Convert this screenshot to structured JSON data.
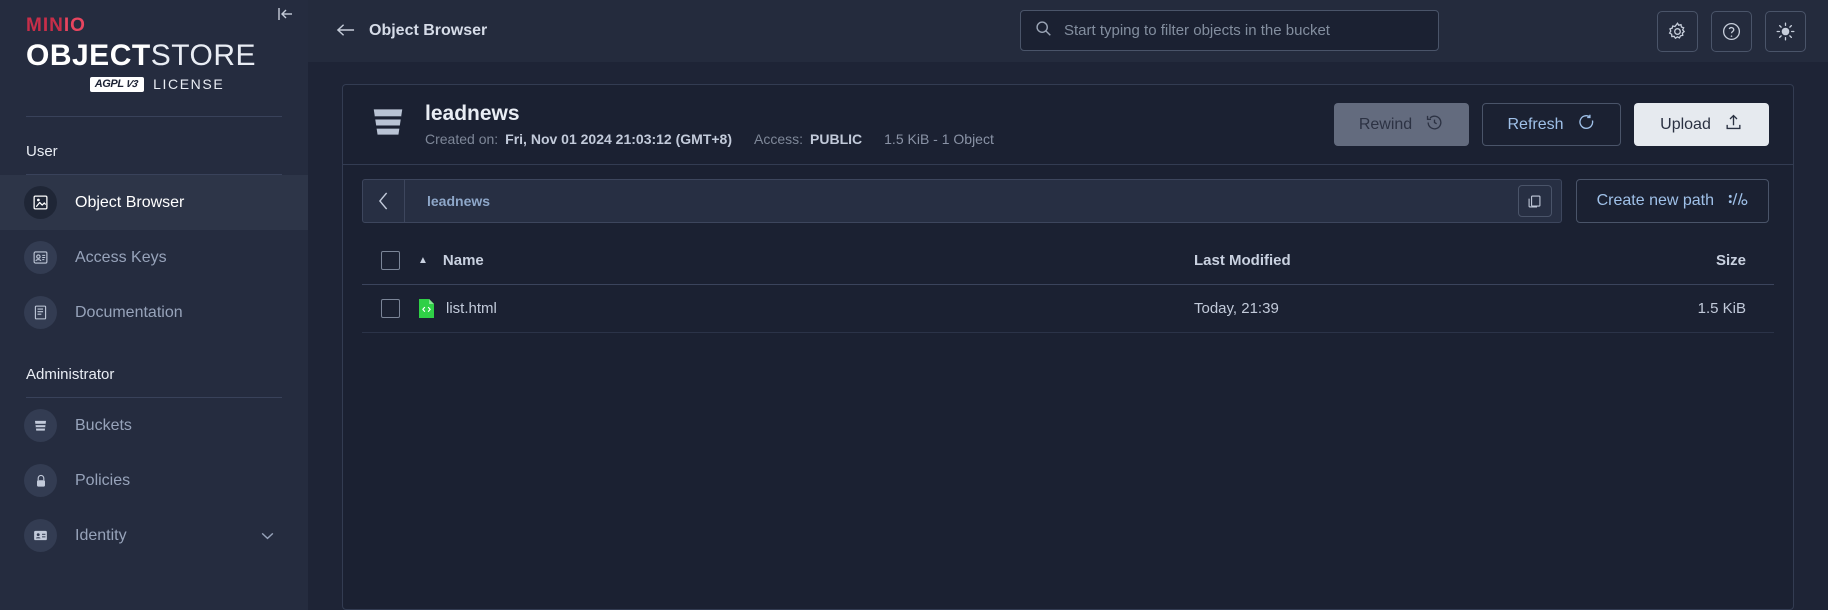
{
  "sidebar": {
    "logo": {
      "brand": "MIN",
      "brand_suffix": "IO",
      "product_bold": "OBJECT",
      "product_light": "STORE",
      "badge": "AGPL",
      "badge_version": "V3",
      "license": "LICENSE"
    },
    "collapse_icon": "collapse-left-icon",
    "groups": [
      {
        "title": "User",
        "items": [
          {
            "label": "Object Browser",
            "icon": "object-browser-icon",
            "active": true
          },
          {
            "label": "Access Keys",
            "icon": "access-keys-icon",
            "active": false
          },
          {
            "label": "Documentation",
            "icon": "documentation-icon",
            "active": false
          }
        ]
      },
      {
        "title": "Administrator",
        "items": [
          {
            "label": "Buckets",
            "icon": "bucket-icon",
            "active": false
          },
          {
            "label": "Policies",
            "icon": "lock-icon",
            "active": false
          },
          {
            "label": "Identity",
            "icon": "identity-card-icon",
            "active": false,
            "expandable": true
          }
        ]
      }
    ]
  },
  "topbar": {
    "back_icon": "arrow-left-icon",
    "title": "Object Browser",
    "search": {
      "placeholder": "Start typing to filter objects in the bucket",
      "value": "",
      "icon": "search-icon"
    },
    "actions": [
      {
        "name": "settings-button",
        "icon": "gear-icon"
      },
      {
        "name": "help-button",
        "icon": "question-circle-icon"
      },
      {
        "name": "theme-toggle-button",
        "icon": "sun-icon"
      }
    ]
  },
  "bucket": {
    "icon": "bucket-icon",
    "name": "leadnews",
    "created_label": "Created on:",
    "created_value": "Fri, Nov 01 2024 21:03:12 (GMT+8)",
    "access_label": "Access:",
    "access_value": "PUBLIC",
    "summary": "1.5 KiB - 1 Object",
    "buttons": {
      "rewind": "Rewind",
      "rewind_icon": "rewind-clock-icon",
      "rewind_disabled": true,
      "refresh": "Refresh",
      "refresh_icon": "refresh-icon",
      "upload": "Upload",
      "upload_icon": "upload-icon"
    }
  },
  "pathbar": {
    "back_icon": "chevron-left-icon",
    "path": "leadnews",
    "copy_icon": "copy-icon",
    "create_path_label": "Create new path",
    "create_path_icon": "path-slash-icon"
  },
  "table": {
    "select_all_checked": false,
    "columns": [
      {
        "key": "name",
        "label": "Name",
        "sorted": "asc"
      },
      {
        "key": "modified",
        "label": "Last Modified"
      },
      {
        "key": "size",
        "label": "Size"
      }
    ],
    "rows": [
      {
        "checked": false,
        "icon": "html-file-icon",
        "icon_color": "#2fd046",
        "name": "list.html",
        "modified": "Today, 21:39",
        "size": "1.5 KiB"
      }
    ]
  },
  "colors": {
    "sidebar_bg": "#252c3f",
    "topbar_bg": "#242b3d",
    "content_bg": "#1e2436",
    "panel_bg": "#1b2132",
    "accent_link": "#9fc0e8",
    "brand_red": "#c72e49",
    "upload_bg": "#e6eaef",
    "file_green": "#2fd046"
  }
}
